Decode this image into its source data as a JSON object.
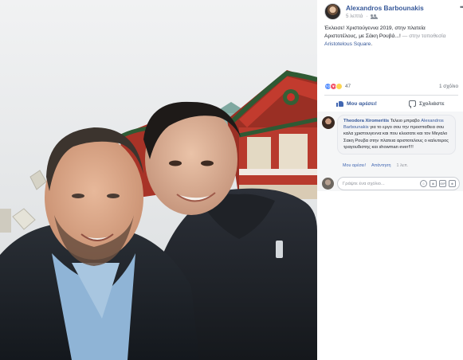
{
  "post": {
    "author_name": "Alexandros Barbounakis",
    "time": "5 λεπτά",
    "audience_icon": "friends-icon",
    "more_icon": "ellipsis-icon",
    "text_main": "Έκλεισε! Χριστούγεννα 2019, στην πλατεία Αριστοτέλους, με Σάκη Ρουβά...!",
    "text_location_prefix": " — στην τοποθεσία ",
    "location": "Aristotelous Square",
    "location_suffix": "."
  },
  "stats": {
    "reaction_icons": [
      "like-reaction",
      "love-reaction",
      "wow-reaction"
    ],
    "reaction_count": "47",
    "comment_count": "1 σχόλιο"
  },
  "actions": {
    "like_label": "Μου αρέσει!",
    "comment_label": "Σχολιάστε"
  },
  "comment": {
    "author": "Theodora Xiromeritis",
    "text_start": " Τελειο μπραβο ",
    "tagged": "Alexandros Barbounakis",
    "text_rest": " για το εργο σου την προσπαθεια σου καλα χριστουγεννα και που κλεισατε και τον Μεγαλο Σακη Ρουβα στην πλατεια αριστοτελους ο καλυτερος τραγουδιστης και showman ever!!!!",
    "like_action": "Μου αρέσει!",
    "reply_action": "Απάντηση",
    "time": "1 λεπ."
  },
  "composer": {
    "placeholder": "Γράψτε ένα σχόλιο...",
    "tools": [
      "emoji-icon",
      "camera-icon",
      "gif-icon",
      "sticker-icon"
    ]
  },
  "colors": {
    "link": "#365899",
    "like_active": "#4267b2",
    "muted": "#90949c",
    "divider": "#dadde1"
  }
}
